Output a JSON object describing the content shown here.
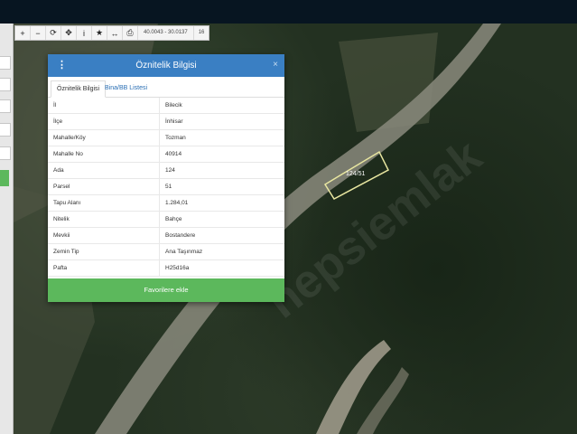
{
  "toolbar": {
    "buttons": [
      "+",
      "−",
      "⟳",
      "✥",
      "i",
      "★",
      "↔",
      "⎙"
    ],
    "coordinates": "40.0043 - 30.0137",
    "zoom": "16"
  },
  "dialog": {
    "title": "Öznitelik Bilgisi",
    "close": "×",
    "tabs": [
      "Öznitelik Bilgisi",
      "Bina/BB Listesi"
    ],
    "rows": [
      {
        "key": "İl",
        "value": "Bilecik"
      },
      {
        "key": "İlçe",
        "value": "İnhisar"
      },
      {
        "key": "Mahalle/Köy",
        "value": "Tozman"
      },
      {
        "key": "Mahalle No",
        "value": "40914"
      },
      {
        "key": "Ada",
        "value": "124"
      },
      {
        "key": "Parsel",
        "value": "51"
      },
      {
        "key": "Tapu Alanı",
        "value": "1.284,01"
      },
      {
        "key": "Nitelik",
        "value": "Bahçe"
      },
      {
        "key": "Mevkii",
        "value": "Bostandere"
      },
      {
        "key": "Zemin Tip",
        "value": "Ana Taşınmaz"
      },
      {
        "key": "Pafta",
        "value": "H25d16a"
      }
    ],
    "favorite_button": "Favorilere ekle"
  },
  "map": {
    "parcel_label": "124/51"
  },
  "colors": {
    "header_blue": "#3a7fc3",
    "button_green": "#5cb85c",
    "topbar": "#071521",
    "parcel_outline": "#e8e6a0"
  }
}
